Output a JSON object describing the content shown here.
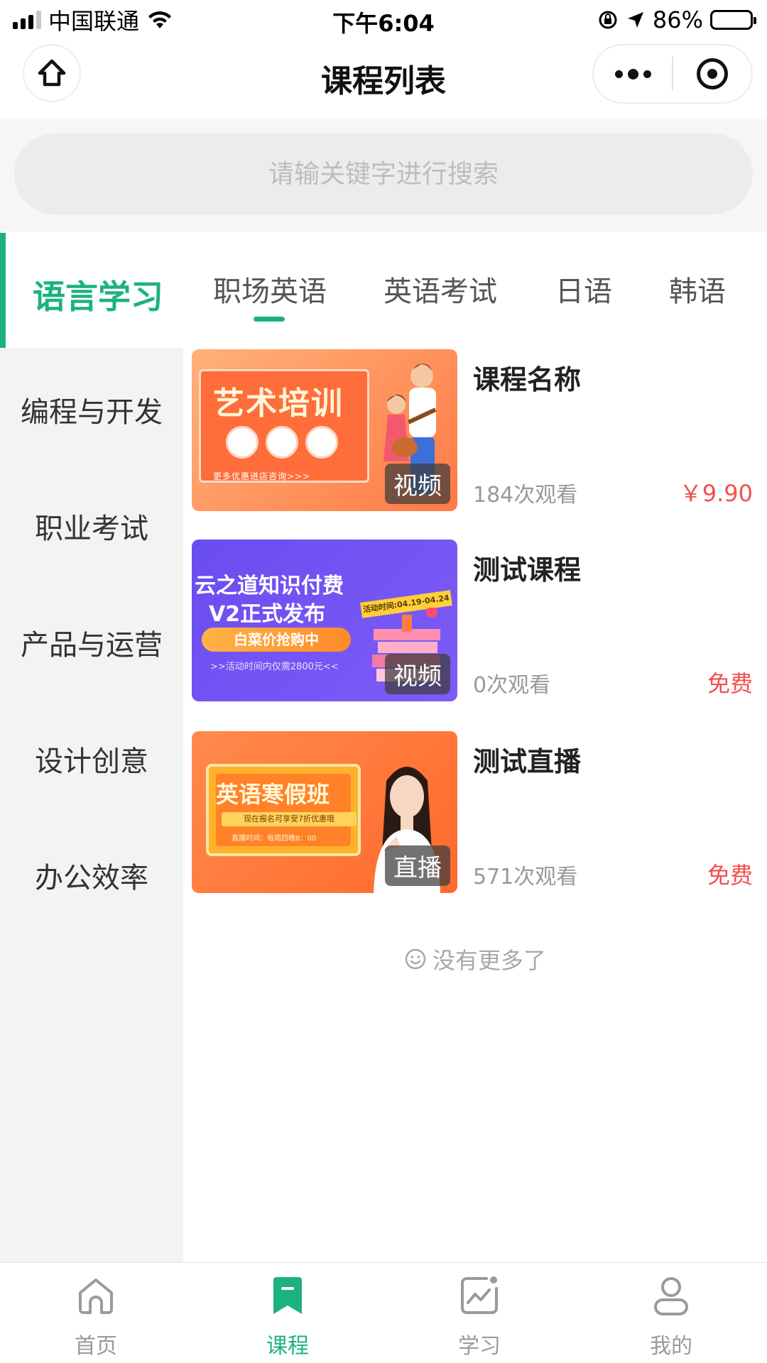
{
  "status_bar": {
    "carrier": "中国联通",
    "time": "下午6:04",
    "battery": "86%",
    "battery_level": 0.86
  },
  "nav": {
    "title": "课程列表",
    "home_icon": "home-icon",
    "more_icon": "more-dots-icon",
    "close_icon": "target-icon"
  },
  "search": {
    "placeholder": "请输关键字进行搜索",
    "value": ""
  },
  "category_tabs": [
    {
      "label": "语言学习",
      "active": true
    },
    {
      "label": "职场英语",
      "active": false
    },
    {
      "label": "英语考试",
      "active": false
    },
    {
      "label": "日语",
      "active": false
    },
    {
      "label": "韩语",
      "active": false
    }
  ],
  "side_menu": [
    {
      "label": "编程与开发"
    },
    {
      "label": "职业考试"
    },
    {
      "label": "产品与运营"
    },
    {
      "label": "设计创意"
    },
    {
      "label": "办公效率"
    }
  ],
  "courses": [
    {
      "title": "课程名称",
      "views": "184次观看",
      "price": "￥9.90",
      "badge": "视频",
      "thumb": {
        "headline": "艺术培训",
        "sub": "更多优惠进店咨询>>>"
      }
    },
    {
      "title": "测试课程",
      "views": "0次观看",
      "price": "免费",
      "badge": "视频",
      "thumb": {
        "line1": "云之道知识付费",
        "line2": "V2正式发布",
        "pill": "白菜价抢购中",
        "small": ">>活动时间内仅需2800元<<",
        "tag": "活动时间:04.19-04.24"
      }
    },
    {
      "title": "测试直播",
      "views": "571次观看",
      "price": "免费",
      "badge": "直播",
      "thumb": {
        "headline": "英语寒假班",
        "sub1": "现在报名可享受7折优惠哦",
        "sub2": "直播时间：每周四晚8：00"
      }
    }
  ],
  "end_note": "没有更多了",
  "tab_bar": [
    {
      "label": "首页",
      "icon": "home-outline-icon",
      "active": false
    },
    {
      "label": "课程",
      "icon": "bookmark-icon",
      "active": true
    },
    {
      "label": "学习",
      "icon": "chart-icon",
      "active": false
    },
    {
      "label": "我的",
      "icon": "user-icon",
      "active": false
    }
  ],
  "colors": {
    "accent": "#1db27d",
    "price": "#f24e4e",
    "muted": "#999999"
  }
}
